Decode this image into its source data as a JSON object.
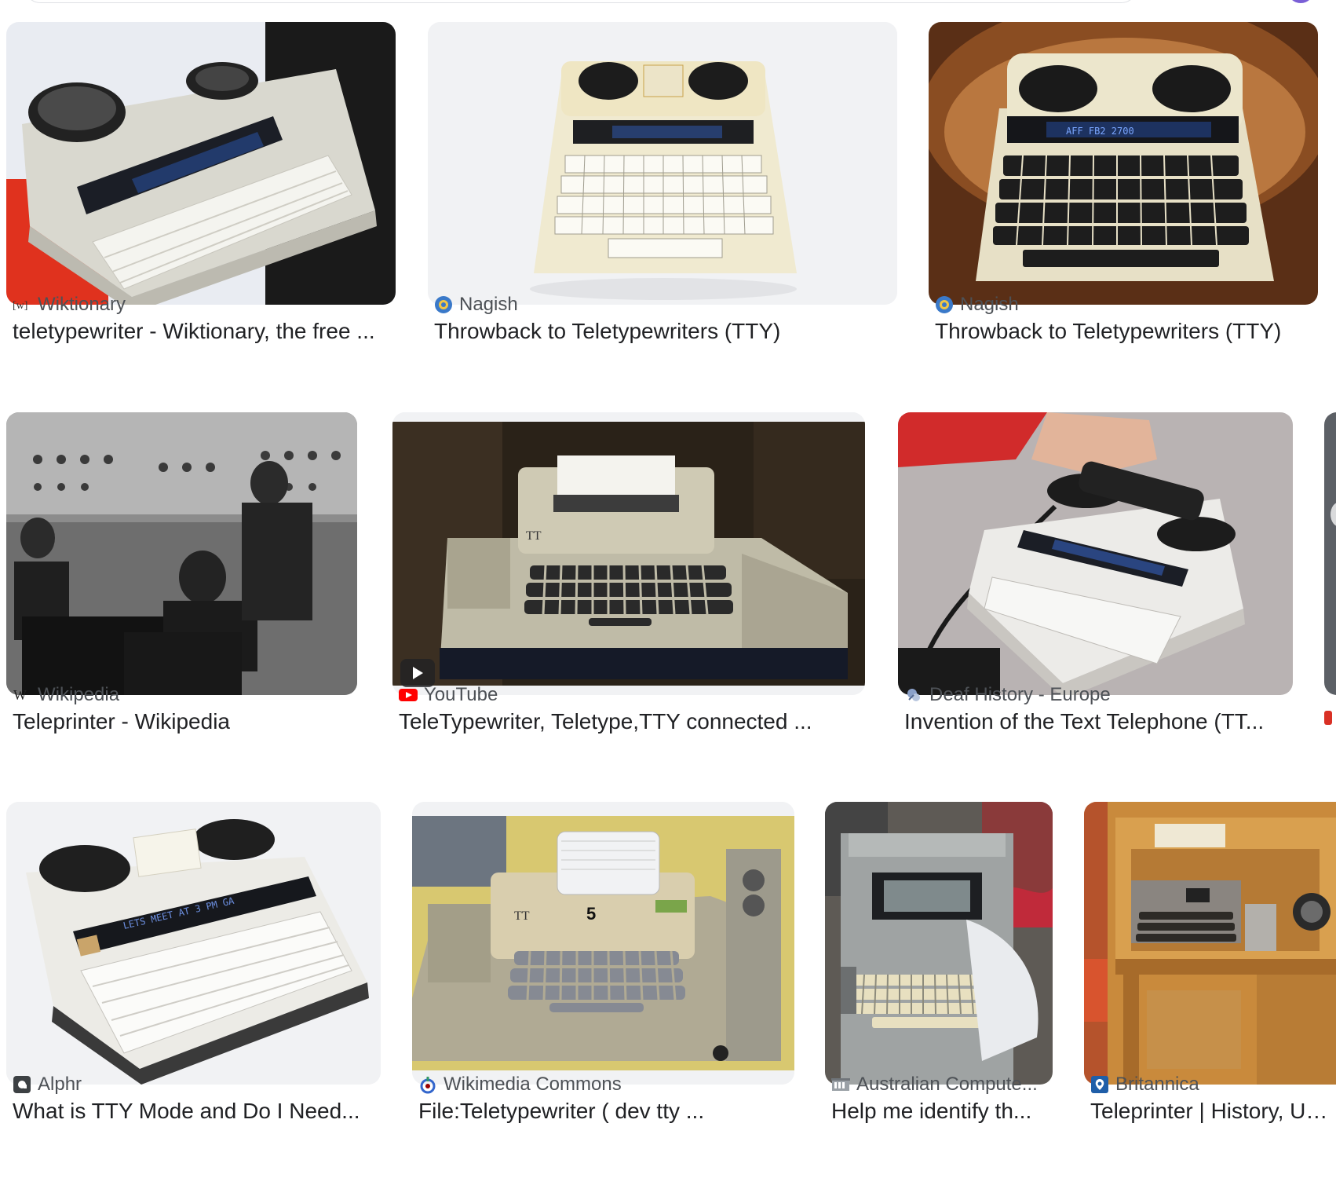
{
  "results": [
    {
      "source": "Wiktionary",
      "title": "teletypewriter - Wiktionary, the free ...",
      "favicon": "wiktionary-icon"
    },
    {
      "source": "Nagish",
      "title": "Throwback to Teletypewriters (TTY)",
      "favicon": "nagish-icon"
    },
    {
      "source": "Nagish",
      "title": "Throwback to Teletypewriters (TTY)",
      "favicon": "nagish-icon"
    },
    {
      "source": "Wikipedia",
      "title": "Teleprinter - Wikipedia",
      "favicon": "wikipedia-icon"
    },
    {
      "source": "YouTube",
      "title": "TeleTypewriter, Teletype,TTY connected ...",
      "favicon": "youtube-icon",
      "video": true
    },
    {
      "source": "Deaf History - Europe",
      "title": "Invention of the Text Telephone (TT...",
      "favicon": "deaf-history-icon"
    },
    {
      "source": "Alphr",
      "title": "What is TTY Mode and Do I Need...",
      "favicon": "alphr-icon"
    },
    {
      "source": "Wikimedia Commons",
      "title": "File:Teletypewriter ( dev tty ...",
      "favicon": "wikimedia-icon"
    },
    {
      "source": "Australian Compute...",
      "title": "Help me identify th...",
      "favicon": "australian-computer-icon"
    },
    {
      "source": "Britannica",
      "title": "Teleprinter | History, Us...",
      "favicon": "britannica-icon"
    }
  ],
  "thumbnail_text": {
    "display_1": "AFF FB2 2700",
    "display_2": "LETS MEET AT 3 PM GA",
    "key_number": "5",
    "teletype_logo": "TT"
  },
  "colors": {
    "source_text": "#4d5156",
    "title_text": "#202124",
    "youtube_red": "#ff0000",
    "nagish_blue": "#3a79c9"
  }
}
